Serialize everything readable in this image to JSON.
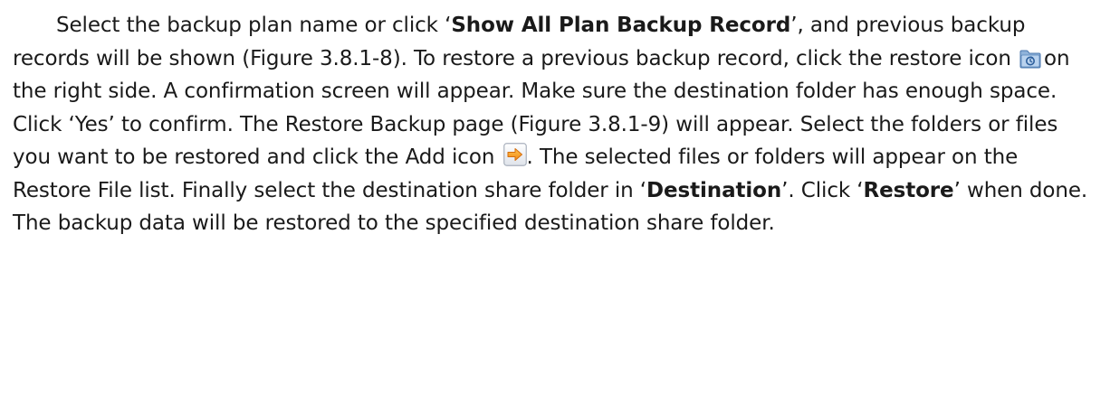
{
  "paragraph": {
    "s1_pre": "Select the backup plan name or click ‘",
    "s1_bold": "Show All Plan Backup Record",
    "s1_post": "’, and previous backup records will be shown (Figure 3.8.1-8). To restore a previous backup record, click the restore icon ",
    "s2": "on the right side. A confirmation screen will appear. Make sure the destination folder has enough space. Click ‘Yes’ to confirm. The Restore Backup page (Figure 3.8.1-9) will appear. Select the folders or files you want to be restored and click the Add icon ",
    "s3_pre": ". The selected files or folders will appear on the Restore File list. Finally select the destination share folder in ‘",
    "s3_bold": "Destination",
    "s3_mid": "’. Click ‘",
    "s3_bold2": "Restore",
    "s3_post": "’ when done. The backup data will be restored to the specified destination share folder."
  },
  "icons": {
    "restore": "restore-icon",
    "add": "add-icon"
  }
}
